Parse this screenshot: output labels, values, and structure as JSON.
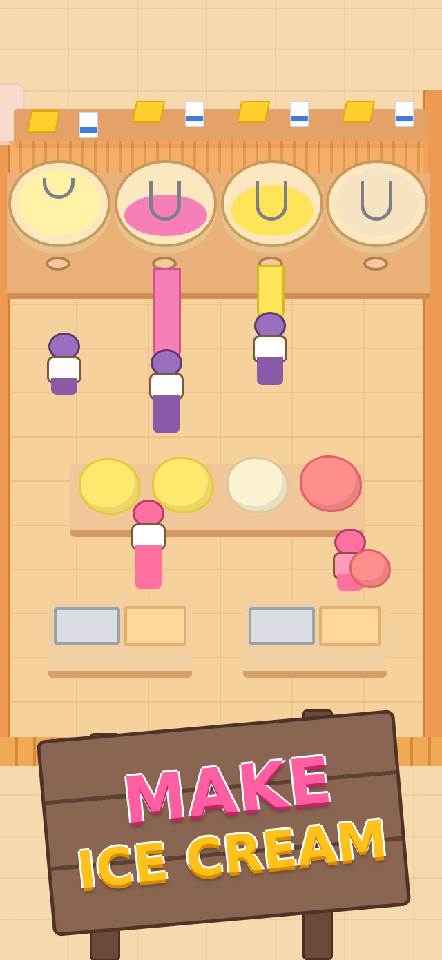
{
  "banner": {
    "line1": "MAKE",
    "line2": "ICE CREAM"
  },
  "colors": {
    "floor": "#f7d19c",
    "wall": "#ee9a52",
    "vanilla": "#fff1a6",
    "strawberry": "#f77fb8",
    "lemon": "#ffe45a",
    "title_pink": "#ff5fa2",
    "title_yellow": "#ffc21b"
  },
  "scene": {
    "mixers": [
      {
        "flavor": "vanilla",
        "state": "full"
      },
      {
        "flavor": "strawberry",
        "state": "mixing"
      },
      {
        "flavor": "lemon",
        "state": "mixing"
      },
      {
        "flavor": "empty",
        "state": "empty"
      }
    ],
    "scoops": [
      "yellow",
      "yellow",
      "vanilla",
      "strawberry"
    ],
    "stations": 2,
    "workers": 5
  }
}
